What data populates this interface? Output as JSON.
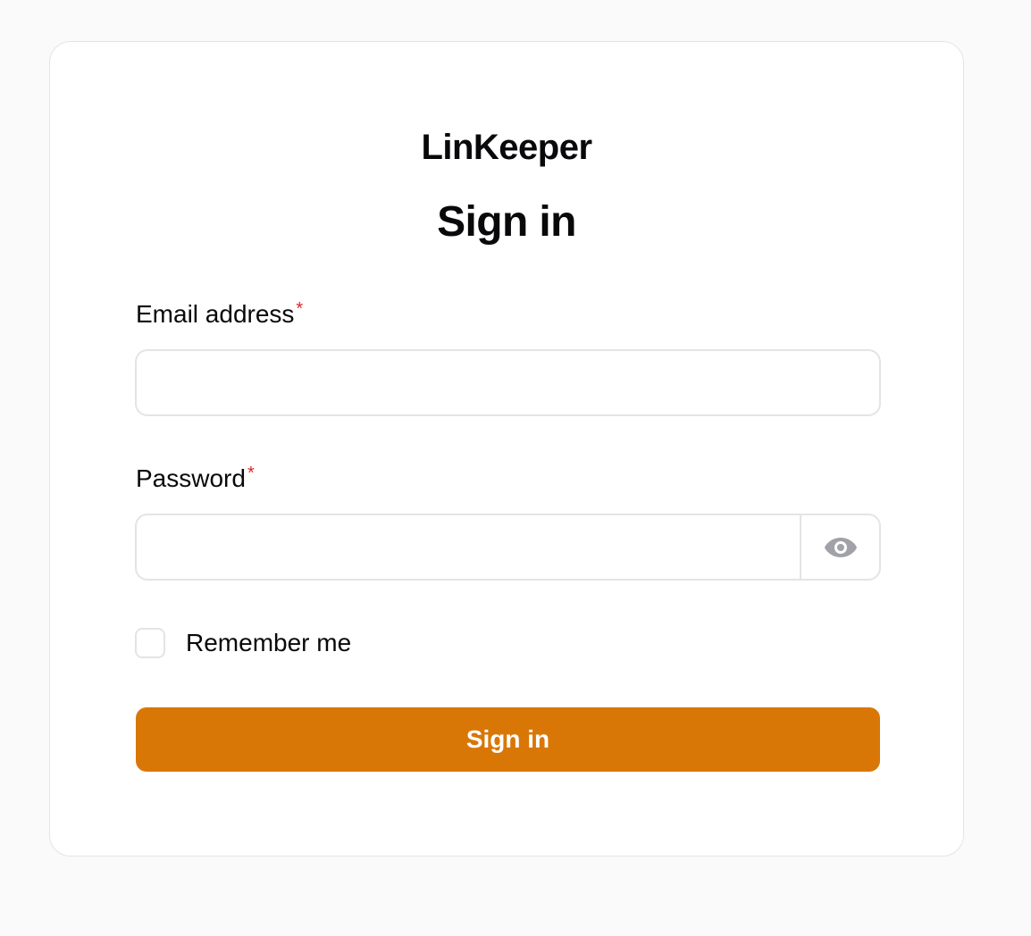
{
  "app": {
    "brand": "LinKeeper",
    "title": "Sign in"
  },
  "form": {
    "email": {
      "label": "Email address",
      "required_mark": "*",
      "value": "",
      "placeholder": ""
    },
    "password": {
      "label": "Password",
      "required_mark": "*",
      "value": "",
      "placeholder": "",
      "toggle_icon": "eye-icon"
    },
    "remember": {
      "label": "Remember me",
      "checked": false
    },
    "submit_label": "Sign in"
  },
  "colors": {
    "accent": "#d97706",
    "required": "#dc2626",
    "background": "#fafafa",
    "card": "#ffffff",
    "border": "#e4e4e7",
    "icon": "#a1a1aa"
  }
}
